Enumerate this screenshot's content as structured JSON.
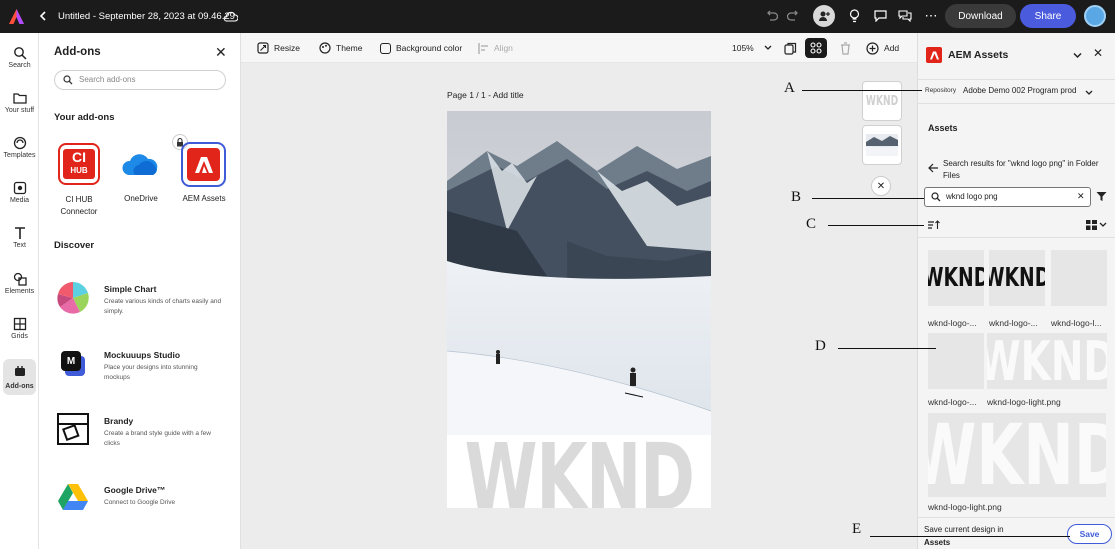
{
  "topbar": {
    "doc_title": "Untitled - September 28, 2023 at 09.46.29",
    "download_label": "Download",
    "share_label": "Share"
  },
  "rail": {
    "items": [
      {
        "label": "Search",
        "icon": "search-icon"
      },
      {
        "label": "Your stuff",
        "icon": "folder-icon"
      },
      {
        "label": "Templates",
        "icon": "templates-icon"
      },
      {
        "label": "Media",
        "icon": "media-icon"
      },
      {
        "label": "Text",
        "icon": "text-icon"
      },
      {
        "label": "Elements",
        "icon": "elements-icon"
      },
      {
        "label": "Grids",
        "icon": "grids-icon"
      },
      {
        "label": "Add-ons",
        "icon": "addons-icon"
      }
    ]
  },
  "addons_panel": {
    "title": "Add-ons",
    "search_placeholder": "Search add-ons",
    "your_addons_heading": "Your add-ons",
    "your_addons": [
      {
        "name": "CI HUB Connector",
        "line1": "CI HUB",
        "line2": "Connector"
      },
      {
        "name": "OneDrive"
      },
      {
        "name": "AEM Assets"
      }
    ],
    "discover_heading": "Discover",
    "discover": [
      {
        "name": "Simple Chart",
        "desc": "Create various kinds of charts easily and simply."
      },
      {
        "name": "Mockuuups Studio",
        "desc": "Place your designs into stunning mockups"
      },
      {
        "name": "Brandy",
        "desc": "Create a brand style guide with a few clicks"
      },
      {
        "name": "Google Drive™",
        "desc": "Connect to Google Drive"
      }
    ]
  },
  "toolbar": {
    "resize": "Resize",
    "theme": "Theme",
    "background_color": "Background color",
    "align": "Align",
    "zoom": "105%",
    "add": "Add"
  },
  "canvas": {
    "page_label": "Page 1 / 1 - ",
    "add_title": "Add title",
    "wknd_text": "WKND",
    "thumb1_text": "WKND"
  },
  "aem": {
    "title": "AEM Assets",
    "repository_label": "Repository",
    "repository_value": "Adobe Demo 002 Program prod",
    "assets_heading": "Assets",
    "search_results": "Search results for \"wknd logo png\" in Folder Files",
    "search_value": "wknd logo png",
    "assets": [
      {
        "name": "wknd-logo-...",
        "thumb": "WKND",
        "style": "dark"
      },
      {
        "name": "wknd-logo-...",
        "thumb": "WKND",
        "style": "dark"
      },
      {
        "name": "wknd-logo-l...",
        "thumb": "",
        "style": "blank"
      },
      {
        "name": "wknd-logo-...",
        "thumb": "",
        "style": "blank"
      },
      {
        "name": "wknd-logo-light.png",
        "thumb": "WKND",
        "style": "light"
      },
      {
        "name": "wknd-logo-light.png",
        "thumb": "WKND",
        "style": "light"
      }
    ],
    "save_text_line1": "Save current design in",
    "save_text_line2": "Assets",
    "save_label": "Save"
  },
  "annotations": {
    "a": "A",
    "b": "B",
    "c": "C",
    "d": "D",
    "e": "E"
  },
  "colors": {
    "topbar": "#1b1b1b",
    "share": "#4b5bde",
    "aem_red": "#e1251b",
    "save_border": "#3f5bd8"
  }
}
